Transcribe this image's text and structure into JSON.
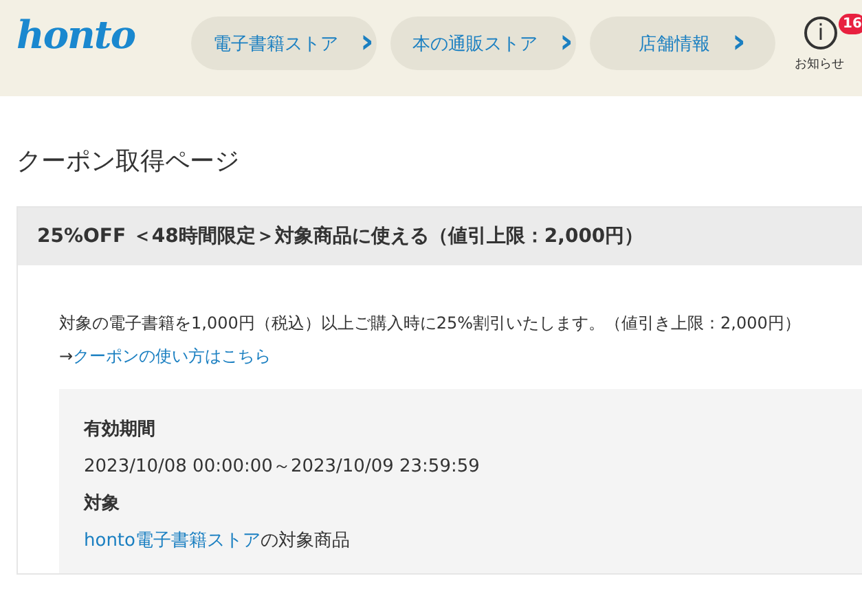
{
  "header": {
    "logo": "honto",
    "nav": [
      {
        "label": "電子書籍ストア",
        "chevron": "›"
      },
      {
        "label": "本の通販ストア",
        "chevron": "›"
      },
      {
        "label": "店舗情報",
        "chevron": "›"
      }
    ],
    "notice": {
      "icon": "i",
      "badge": "16",
      "label": "お知らせ"
    }
  },
  "page_title": "クーポン取得ページ",
  "coupon": {
    "title": "25%OFF ＜48時間限定＞対象商品に使える（値引上限：2,000円）",
    "description": "対象の電子書籍を1,000円（税込）以上ご購入時に25%割引いたします。（値引き上限：2,000円）",
    "howto": {
      "prefix": "→",
      "link": "クーポンの使い方はこちら"
    },
    "details": [
      {
        "label": "有効期間",
        "value": "2023/10/08 00:00:00～2023/10/09 23:59:59"
      },
      {
        "label": "対象",
        "link": "honto電子書籍ストア",
        "value": "の対象商品"
      }
    ]
  }
}
